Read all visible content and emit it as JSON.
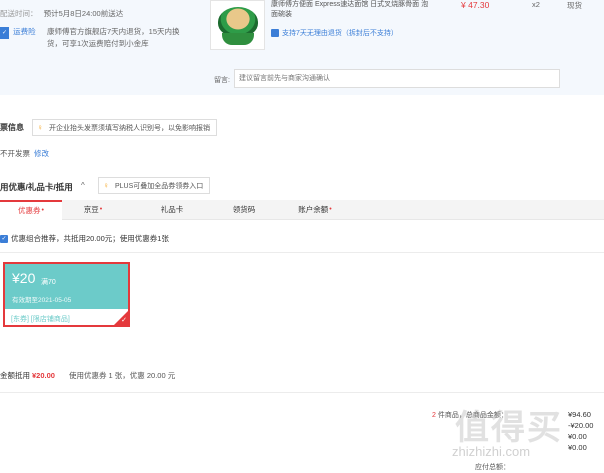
{
  "order": {
    "delivery_label": "配送时间：",
    "delivery_value": "预计5月8日24:00前送达",
    "freight_label": "运费险",
    "freight_text": "康师傅官方旗舰店7天内退货，15天内换货，可享1次运费赔付到小金库",
    "product_title": "康师傅方便面 Express速达面馆 日式叉烧豚骨面 泡面碗装",
    "product_service": "支持7天无理由退货（拆封后不支持）",
    "price": "¥ 47.30",
    "qty": "x2",
    "stock": "现货",
    "remark_label": "留言:",
    "remark_placeholder": "建议留言前先与商家沟通确认"
  },
  "invoice": {
    "title": "票信息",
    "notice": "开企业抬头发票须填写纳税人识别号，以免影响报销",
    "value": "不开发票",
    "edit": "修改"
  },
  "discount": {
    "title": "用优惠/礼品卡/抵用",
    "chevron": "^",
    "plus_notice": "PLUS可叠加全品券领券入口",
    "tabs": [
      {
        "label": "优惠券",
        "dot": "•"
      },
      {
        "label": "京豆",
        "dot": "•"
      },
      {
        "label": "礼品卡",
        "dot": ""
      },
      {
        "label": "领货码",
        "dot": ""
      },
      {
        "label": "账户余额",
        "dot": "•"
      }
    ],
    "combo_text": "优惠组合推荐，共抵用20.00元；使用优惠券1张",
    "combo_check": "✓",
    "coupon": {
      "amount": "¥20",
      "limit": "满70",
      "expire": "有效期至2021-05-05",
      "tag1": "[东券]",
      "tag2": "[限店铺商品]",
      "check": "✓"
    },
    "summary_label": "金额抵用",
    "summary_amount": "¥20.00",
    "summary_desc": "使用优惠券 1 张，优惠 20.00 元"
  },
  "totals": {
    "count": "2",
    "count_text": "件商品，总商品金额：",
    "values": [
      "¥94.60",
      "-¥20.00",
      "¥0.00",
      "¥0.00"
    ],
    "last_label": "应付总额：",
    "watermark": "值得买",
    "watermark_sub": "zhizhizhi.com"
  }
}
